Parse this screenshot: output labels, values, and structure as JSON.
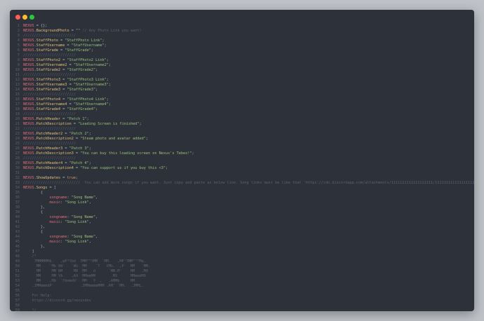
{
  "window": {
    "buttons": [
      "close",
      "minimize",
      "maximize"
    ],
    "colors": {
      "background": "#2c313a",
      "close": "#ff5f56",
      "minimize": "#ffbd2e",
      "maximize": "#27c93f"
    }
  },
  "code_lines": [
    {
      "n": "1",
      "tokens": [
        [
          "var",
          "NEXUS"
        ],
        [
          "op",
          " = {};"
        ]
      ]
    },
    {
      "n": "2",
      "tokens": [
        [
          "var",
          "NEXUS"
        ],
        [
          "op",
          "."
        ],
        [
          "prop",
          "BackgroundPhoto"
        ],
        [
          "op",
          " = "
        ],
        [
          "str",
          "\"\""
        ],
        [
          "op",
          " "
        ],
        [
          "com",
          "// Any Photo Link you want!"
        ]
      ]
    },
    {
      "n": "3",
      "tokens": [
        [
          "com",
          "////////////////////////"
        ]
      ]
    },
    {
      "n": "4",
      "tokens": [
        [
          "var",
          "NEXUS"
        ],
        [
          "op",
          "."
        ],
        [
          "prop",
          "StaffPhoto"
        ],
        [
          "op",
          " = "
        ],
        [
          "str",
          "\"StaffPhoto Link\""
        ],
        [
          "op",
          ";"
        ]
      ]
    },
    {
      "n": "5",
      "tokens": [
        [
          "var",
          "NEXUS"
        ],
        [
          "op",
          "."
        ],
        [
          "prop",
          "StaffUsername"
        ],
        [
          "op",
          " = "
        ],
        [
          "str",
          "\"StaffUsername\""
        ],
        [
          "op",
          ";"
        ]
      ]
    },
    {
      "n": "6",
      "tokens": [
        [
          "var",
          "NEXUS"
        ],
        [
          "op",
          "."
        ],
        [
          "prop",
          "StaffGrade"
        ],
        [
          "op",
          " = "
        ],
        [
          "str",
          "\"StaffGrade\""
        ],
        [
          "op",
          ";"
        ]
      ]
    },
    {
      "n": "7",
      "tokens": [
        [
          "com",
          "////////////////////////"
        ]
      ]
    },
    {
      "n": "8",
      "tokens": [
        [
          "var",
          "NEXUS"
        ],
        [
          "op",
          "."
        ],
        [
          "prop",
          "StaffPhoto2"
        ],
        [
          "op",
          " = "
        ],
        [
          "str",
          "\"StaffPhoto2 Link\""
        ],
        [
          "op",
          ";"
        ]
      ]
    },
    {
      "n": "9",
      "tokens": [
        [
          "var",
          "NEXUS"
        ],
        [
          "op",
          "."
        ],
        [
          "prop",
          "StaffUsername2"
        ],
        [
          "op",
          " = "
        ],
        [
          "str",
          "\"StaffUsername2\""
        ],
        [
          "op",
          ";"
        ]
      ]
    },
    {
      "n": "10",
      "tokens": [
        [
          "var",
          "NEXUS"
        ],
        [
          "op",
          "."
        ],
        [
          "prop",
          "StaffGrade2"
        ],
        [
          "op",
          " = "
        ],
        [
          "str",
          "\"StaffGrade2\""
        ],
        [
          "op",
          ";"
        ]
      ]
    },
    {
      "n": "11",
      "tokens": [
        [
          "com",
          "////////////////////////"
        ]
      ]
    },
    {
      "n": "12",
      "tokens": [
        [
          "var",
          "NEXUS"
        ],
        [
          "op",
          "."
        ],
        [
          "prop",
          "StaffPhoto3"
        ],
        [
          "op",
          " = "
        ],
        [
          "str",
          "\"StaffPhoto3 Link\""
        ],
        [
          "op",
          ";"
        ]
      ]
    },
    {
      "n": "13",
      "tokens": [
        [
          "var",
          "NEXUS"
        ],
        [
          "op",
          "."
        ],
        [
          "prop",
          "StaffUsername3"
        ],
        [
          "op",
          " = "
        ],
        [
          "str",
          "\"StaffUsername3\""
        ],
        [
          "op",
          ";"
        ]
      ]
    },
    {
      "n": "14",
      "tokens": [
        [
          "var",
          "NEXUS"
        ],
        [
          "op",
          "."
        ],
        [
          "prop",
          "StaffGrade3"
        ],
        [
          "op",
          " = "
        ],
        [
          "str",
          "\"StaffGrade3\""
        ],
        [
          "op",
          ";"
        ]
      ]
    },
    {
      "n": "15",
      "tokens": [
        [
          "com",
          "////////////////////////"
        ]
      ]
    },
    {
      "n": "16",
      "tokens": [
        [
          "var",
          "NEXUS"
        ],
        [
          "op",
          "."
        ],
        [
          "prop",
          "StaffPhoto4"
        ],
        [
          "op",
          " = "
        ],
        [
          "str",
          "\"StaffPhoto4 Link\""
        ],
        [
          "op",
          ";"
        ]
      ]
    },
    {
      "n": "17",
      "tokens": [
        [
          "var",
          "NEXUS"
        ],
        [
          "op",
          "."
        ],
        [
          "prop",
          "StaffUsername4"
        ],
        [
          "op",
          " = "
        ],
        [
          "str",
          "\"StaffUsername4\""
        ],
        [
          "op",
          ";"
        ]
      ]
    },
    {
      "n": "18",
      "tokens": [
        [
          "var",
          "NEXUS"
        ],
        [
          "op",
          "."
        ],
        [
          "prop",
          "StaffGrade4"
        ],
        [
          "op",
          " = "
        ],
        [
          "str",
          "\"StaffGrade4\""
        ],
        [
          "op",
          ";"
        ]
      ]
    },
    {
      "n": "19",
      "tokens": [
        [
          "com",
          "////////////////////////"
        ]
      ]
    },
    {
      "n": "20",
      "tokens": [
        [
          "var",
          "NEXUS"
        ],
        [
          "op",
          "."
        ],
        [
          "prop",
          "PatchHeader"
        ],
        [
          "op",
          " = "
        ],
        [
          "str",
          "\"Patch 1\""
        ],
        [
          "op",
          ";"
        ]
      ]
    },
    {
      "n": "21",
      "tokens": [
        [
          "var",
          "NEXUS"
        ],
        [
          "op",
          "."
        ],
        [
          "prop",
          "PatchDescription"
        ],
        [
          "op",
          " = "
        ],
        [
          "str",
          "\"Loading Screen is finished\""
        ],
        [
          "op",
          ";"
        ]
      ]
    },
    {
      "n": "22",
      "tokens": [
        [
          "com",
          "////////////////////////"
        ]
      ]
    },
    {
      "n": "23",
      "tokens": [
        [
          "var",
          "NEXUS"
        ],
        [
          "op",
          "."
        ],
        [
          "prop",
          "PatchHeader2"
        ],
        [
          "op",
          " = "
        ],
        [
          "str",
          "\"Patch 2\""
        ],
        [
          "op",
          ";"
        ]
      ]
    },
    {
      "n": "24",
      "tokens": [
        [
          "var",
          "NEXUS"
        ],
        [
          "op",
          "."
        ],
        [
          "prop",
          "PatchDescription2"
        ],
        [
          "op",
          " = "
        ],
        [
          "str",
          "\"Steam photo and avatar added\""
        ],
        [
          "op",
          ";"
        ]
      ]
    },
    {
      "n": "25",
      "tokens": [
        [
          "com",
          "////////////////////////"
        ]
      ]
    },
    {
      "n": "26",
      "tokens": [
        [
          "var",
          "NEXUS"
        ],
        [
          "op",
          "."
        ],
        [
          "prop",
          "PatchHeader3"
        ],
        [
          "op",
          " = "
        ],
        [
          "str",
          "\"Patch 3\""
        ],
        [
          "op",
          ";"
        ]
      ]
    },
    {
      "n": "27",
      "tokens": [
        [
          "var",
          "NEXUS"
        ],
        [
          "op",
          "."
        ],
        [
          "prop",
          "PatchDescription3"
        ],
        [
          "op",
          " = "
        ],
        [
          "str",
          "\"You can buy this loading screen on Nexus's Tebex!\""
        ],
        [
          "op",
          ";"
        ]
      ]
    },
    {
      "n": "28",
      "tokens": [
        [
          "com",
          "////////////////////////"
        ]
      ]
    },
    {
      "n": "29",
      "tokens": [
        [
          "var",
          "NEXUS"
        ],
        [
          "op",
          "."
        ],
        [
          "prop",
          "PatchHeader4"
        ],
        [
          "op",
          " = "
        ],
        [
          "str",
          "\"Patch 4\""
        ],
        [
          "op",
          ";"
        ]
      ]
    },
    {
      "n": "30",
      "tokens": [
        [
          "var",
          "NEXUS"
        ],
        [
          "op",
          "."
        ],
        [
          "prop",
          "PatchDescription4"
        ],
        [
          "op",
          " = "
        ],
        [
          "str",
          "\"You can support us if you buy this <3\""
        ],
        [
          "op",
          ";"
        ]
      ]
    },
    {
      "n": "31",
      "tokens": []
    },
    {
      "n": "32",
      "tokens": [
        [
          "var",
          "NEXUS"
        ],
        [
          "op",
          "."
        ],
        [
          "prop",
          "ShowUpdates"
        ],
        [
          "op",
          " = "
        ],
        [
          "kw",
          "true"
        ],
        [
          "op",
          ";"
        ]
      ]
    },
    {
      "n": "33",
      "tokens": [
        [
          "com",
          "//////////////////////////  You can add more songs if you want. Just copy and paste as below line. Song links must be like that 'https://cdn.discordapp.com/attachments/1111111111111111111/1111111111111111111/puvenow.mp3'"
        ]
      ]
    },
    {
      "n": "34",
      "tokens": [
        [
          "var",
          "NEXUS"
        ],
        [
          "op",
          "."
        ],
        [
          "prop",
          "Songs"
        ],
        [
          "op",
          " = ["
        ]
      ]
    },
    {
      "n": "35",
      "tokens": [
        [
          "op",
          "        {"
        ]
      ]
    },
    {
      "n": "36",
      "tokens": [
        [
          "op",
          "            "
        ],
        [
          "key",
          "songname"
        ],
        [
          "op",
          ": "
        ],
        [
          "str",
          "\"Song Name\""
        ],
        [
          "op",
          ","
        ]
      ]
    },
    {
      "n": "37",
      "tokens": [
        [
          "op",
          "            "
        ],
        [
          "key",
          "music"
        ],
        [
          "op",
          ": "
        ],
        [
          "str",
          "\"Song Link\""
        ],
        [
          "op",
          ","
        ]
      ]
    },
    {
      "n": "38",
      "tokens": [
        [
          "op",
          "        },"
        ]
      ]
    },
    {
      "n": "39",
      "tokens": [
        [
          "op",
          "        {"
        ]
      ]
    },
    {
      "n": "40",
      "tokens": [
        [
          "op",
          "            "
        ],
        [
          "key",
          "songname"
        ],
        [
          "op",
          ": "
        ],
        [
          "str",
          "\"Song Name\""
        ],
        [
          "op",
          ","
        ]
      ]
    },
    {
      "n": "41",
      "tokens": [
        [
          "op",
          "            "
        ],
        [
          "key",
          "music"
        ],
        [
          "op",
          ": "
        ],
        [
          "str",
          "\"Song Link\""
        ],
        [
          "op",
          ","
        ]
      ]
    },
    {
      "n": "42",
      "tokens": [
        [
          "op",
          "        },"
        ]
      ]
    },
    {
      "n": "43",
      "tokens": [
        [
          "op",
          "        {"
        ]
      ]
    },
    {
      "n": "44",
      "tokens": [
        [
          "op",
          "            "
        ],
        [
          "key",
          "songname"
        ],
        [
          "op",
          ": "
        ],
        [
          "str",
          "\"Song Name\""
        ],
        [
          "op",
          ","
        ]
      ]
    },
    {
      "n": "45",
      "tokens": [
        [
          "op",
          "            "
        ],
        [
          "key",
          "music"
        ],
        [
          "op",
          ": "
        ],
        [
          "str",
          "\"Song Link\""
        ],
        [
          "op",
          ","
        ]
      ]
    },
    {
      "n": "46",
      "tokens": [
        [
          "op",
          "        },"
        ]
      ]
    },
    {
      "n": "47",
      "tokens": [
        [
          "op",
          "    ]"
        ]
      ]
    },
    {
      "n": "48",
      "tokens": [
        [
          "com",
          "    /*"
        ]
      ]
    },
    {
      "n": "49",
      "tokens": [
        [
          "com",
          "     7MMMMMMb.   ,pP\"Ybd  7MM\"\"YMM  `MM.   ,MP'7MM\"\"\"Mq."
        ]
      ]
    },
    {
      "n": "50",
      "tokens": [
        [
          "com",
          "      MM    `Mb 6W'   `Wb  MM    `7   VMb.  ,P   MM   `MM."
        ]
      ]
    },
    {
      "n": "51",
      "tokens": [
        [
          "com",
          "      MM     MM 8M     M8  MM   d      `MM.M'    MM   ,M9"
        ]
      ]
    },
    {
      "n": "52",
      "tokens": [
        [
          "com",
          "      MM     MM YA.   ,A9  MMmmMM        MV      MMmmdM9"
        ]
      ]
    },
    {
      "n": "53",
      "tokens": [
        [
          "com",
          "      MM    ,M9  `Ybmmd9'  MM   Y  ,   ,AMMb     MM"
        ]
      ]
    },
    {
      "n": "54",
      "tokens": [
        [
          "com",
          "    .JMMmmmdP'            .JMMmmmmMMM .AM' `MM.  .JMML."
        ]
      ]
    },
    {
      "n": "55",
      "tokens": [
        [
          "com",
          ""
        ]
      ]
    },
    {
      "n": "56",
      "tokens": [
        [
          "com",
          "    For Help:"
        ]
      ]
    },
    {
      "n": "57",
      "tokens": [
        [
          "com",
          "    https://discord.gg/nexusdev"
        ]
      ]
    },
    {
      "n": "58",
      "tokens": [
        [
          "com",
          ""
        ]
      ]
    },
    {
      "n": "59",
      "tokens": [
        [
          "com",
          "    */"
        ]
      ]
    }
  ]
}
